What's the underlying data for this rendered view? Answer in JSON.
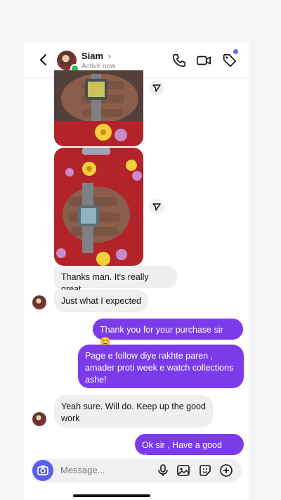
{
  "header": {
    "contact_name": "Siam",
    "status": "Active now"
  },
  "icons": {
    "back": "chevron-left-icon",
    "phone": "phone-icon",
    "video": "video-camera-icon",
    "tag": "tag-icon",
    "share": "send-icon",
    "camera": "camera-icon",
    "mic": "microphone-icon",
    "gallery": "image-icon",
    "sticker": "sticker-icon",
    "plus": "plus-icon"
  },
  "colors": {
    "outgoing_bubble": "#7b3bea",
    "incoming_bubble": "#efefef",
    "online": "#2bc44d",
    "camera_button": "#5b5ff0"
  },
  "messages": {
    "m1": "Thanks man. It's really great",
    "m2": "Just what I expected",
    "m3": "Thank you for your purchase sir 😊",
    "m4": "Page e follow diye rakhte paren , amader proti week e watch collections ashe!",
    "m5": "Yeah sure. Will do. Keep up the good work",
    "m6": "Ok sir , Have a good day"
  },
  "composer": {
    "placeholder": "Message..."
  }
}
